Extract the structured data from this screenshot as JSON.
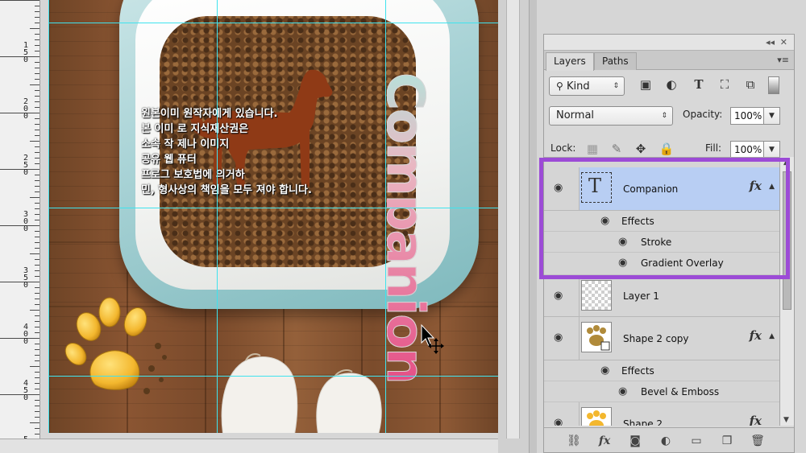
{
  "ruler": {
    "numbers": [
      "1\n5\n0",
      "2\n0\n0",
      "2\n5\n0",
      "3\n0\n0",
      "3\n5\n0",
      "4\n0\n0",
      "4\n5\n0",
      "5\n0\n0"
    ]
  },
  "canvas": {
    "korean_lines": [
      "원본이미        원작자에게 있습니다.",
      "본 이미            로 지식재산권은",
      "소속 작                       제나 이미지",
      "공유 웹                        퓨터",
      "프로그    보호법에 의거하",
      "민, 형사상의 책임을 모두 져야 합니다."
    ],
    "vertical_text": "Companion"
  },
  "panel": {
    "tabs": [
      "Layers",
      "Paths"
    ],
    "filter": {
      "label": "Kind"
    },
    "blend_mode": "Normal",
    "opacity_label": "Opacity:",
    "opacity_value": "100%",
    "lock_label": "Lock:",
    "fill_label": "Fill:",
    "fill_value": "100%",
    "layers": [
      {
        "name": "Companion",
        "selected": true,
        "fx": "fx",
        "effects_label": "Effects",
        "effects": [
          "Stroke",
          "Gradient Overlay"
        ]
      },
      {
        "name": "Layer 1"
      },
      {
        "name": "Shape 2 copy",
        "fx": "fx",
        "effects_label": "Effects",
        "effects": [
          "Bevel & Emboss"
        ]
      },
      {
        "name": "Shape 2",
        "fx": "fx"
      }
    ],
    "footer_icons": [
      "link-icon",
      "fx-icon",
      "mask-icon",
      "adjustment-icon",
      "folder-icon",
      "new-layer-icon",
      "trash-icon"
    ]
  },
  "colors": {
    "guide": "#3fe3ee",
    "highlight": "#9c4bd6",
    "selected_layer": "#b8cef3",
    "dog": "#8f3a16"
  }
}
